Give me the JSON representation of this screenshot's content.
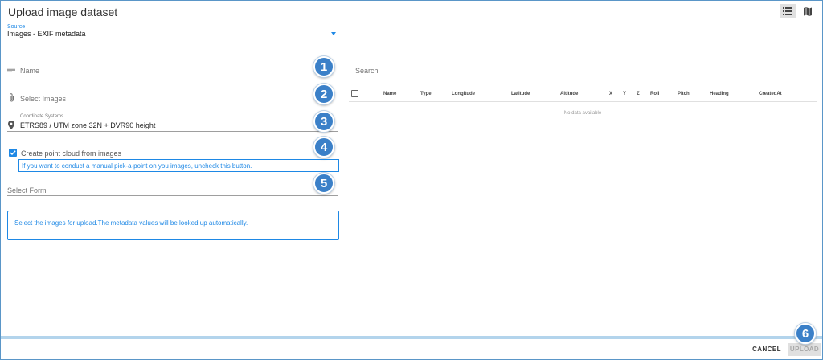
{
  "dialog": {
    "title": "Upload image dataset"
  },
  "toolbar": {
    "list_view_icon": "list-icon",
    "map_view_icon": "map-icon"
  },
  "source": {
    "label": "Source",
    "value": "Images - EXIF metadata"
  },
  "form": {
    "name": {
      "placeholder": "Name",
      "icon": "notes-icon"
    },
    "images": {
      "placeholder": "Select Images",
      "icon": "paperclip-icon"
    },
    "coordinate_system": {
      "label": "Coordinate Systems",
      "value": "ETRS89 / UTM zone 32N + DVR90 height",
      "icon": "map-pin-icon"
    },
    "point_cloud": {
      "label": "Create point cloud from images",
      "checked": true
    },
    "hint": "If you want to conduct a manual pick-a-point on you images, uncheck this button.",
    "select_form": {
      "placeholder": "Select Form"
    },
    "info": "Select the images for upload.The metadata values will be looked up automatically."
  },
  "badges": [
    "1",
    "2",
    "3",
    "4",
    "5",
    "6"
  ],
  "table": {
    "search_placeholder": "Search",
    "columns": [
      "Name",
      "Type",
      "Longitude",
      "Latitude",
      "Altitude",
      "X",
      "Y",
      "Z",
      "Roll",
      "Pitch",
      "Heading",
      "CreatedAt"
    ],
    "empty_text": "No data available"
  },
  "footer": {
    "cancel_label": "CANCEL",
    "upload_label": "UPLOAD"
  },
  "colors": {
    "accent": "#1e88e5",
    "badge": "#3b80c8",
    "border": "#5a96c8"
  }
}
